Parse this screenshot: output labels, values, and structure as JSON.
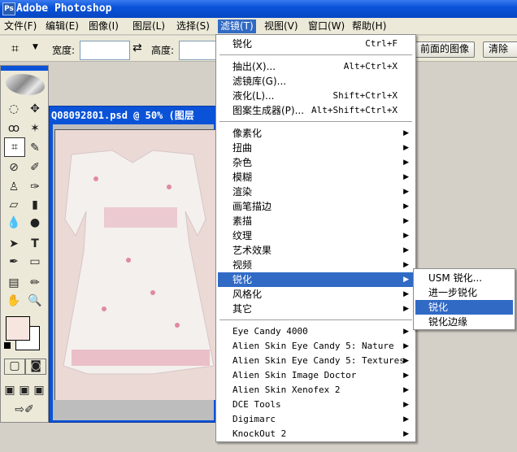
{
  "app": {
    "title": "Adobe Photoshop",
    "icon": "ps-app-icon"
  },
  "menubar": [
    {
      "label": "文件(F)",
      "active": false
    },
    {
      "label": "编辑(E)",
      "active": false
    },
    {
      "label": "图像(I)",
      "active": false
    },
    {
      "label": "图层(L)",
      "active": false
    },
    {
      "label": "选择(S)",
      "active": false
    },
    {
      "label": "滤镜(T)",
      "active": true
    },
    {
      "label": "视图(V)",
      "active": false
    },
    {
      "label": "窗口(W)",
      "active": false
    },
    {
      "label": "帮助(H)",
      "active": false
    }
  ],
  "options": {
    "width_label": "宽度:",
    "height_label": "高度:",
    "front_image_button": "前面的图像",
    "clear_button": "清除"
  },
  "document": {
    "title": "Q08092801.psd @ 50% (图层"
  },
  "filter_menu": {
    "items": [
      {
        "label": "锐化",
        "shortcut": "Ctrl+F"
      },
      {
        "sep": true
      },
      {
        "label": "抽出(X)...",
        "shortcut": "Alt+Ctrl+X"
      },
      {
        "label": "滤镜库(G)..."
      },
      {
        "label": "液化(L)...",
        "shortcut": "Shift+Ctrl+X"
      },
      {
        "label": "图案生成器(P)...",
        "shortcut": "Alt+Shift+Ctrl+X"
      },
      {
        "sep": true
      },
      {
        "label": "像素化",
        "sub": true
      },
      {
        "label": "扭曲",
        "sub": true
      },
      {
        "label": "杂色",
        "sub": true
      },
      {
        "label": "模糊",
        "sub": true
      },
      {
        "label": "渲染",
        "sub": true
      },
      {
        "label": "画笔描边",
        "sub": true
      },
      {
        "label": "素描",
        "sub": true
      },
      {
        "label": "纹理",
        "sub": true
      },
      {
        "label": "艺术效果",
        "sub": true
      },
      {
        "label": "视频",
        "sub": true
      },
      {
        "label": "锐化",
        "sub": true,
        "highlighted": true
      },
      {
        "label": "风格化",
        "sub": true
      },
      {
        "label": "其它",
        "sub": true
      },
      {
        "sep": true
      },
      {
        "label": " Eye Candy 4000",
        "sub": true,
        "mono": true
      },
      {
        "label": "Alien Skin Eye Candy 5: Nature",
        "sub": true,
        "mono": true
      },
      {
        "label": "Alien Skin Eye Candy 5: Textures",
        "sub": true,
        "mono": true
      },
      {
        "label": "Alien Skin Image Doctor",
        "sub": true,
        "mono": true
      },
      {
        "label": "Alien Skin Xenofex 2",
        "sub": true,
        "mono": true
      },
      {
        "label": "DCE Tools",
        "sub": true,
        "mono": true
      },
      {
        "label": "Digimarc",
        "sub": true,
        "mono": true
      },
      {
        "label": "KnockOut 2",
        "sub": true,
        "mono": true
      }
    ]
  },
  "sharpen_submenu": {
    "items": [
      {
        "label": "USM 锐化..."
      },
      {
        "label": "进一步锐化"
      },
      {
        "label": "锐化",
        "highlighted": true
      },
      {
        "label": "锐化边缘"
      }
    ]
  },
  "colors": {
    "foreground": "#f7e6e0",
    "background": "#ffffff",
    "accent": "#316ac5",
    "titlebar": "#0a53d8"
  }
}
